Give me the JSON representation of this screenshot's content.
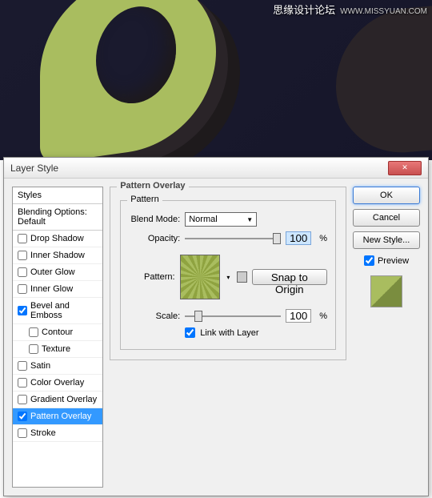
{
  "watermark": {
    "text": "思缘设计论坛",
    "url": "WWW.MISSYUAN.COM"
  },
  "dialog": {
    "title": "Layer Style",
    "close": "✕",
    "styles_header": "Styles",
    "blending_options": "Blending Options: Default",
    "items": [
      {
        "label": "Drop Shadow",
        "checked": false,
        "indent": false
      },
      {
        "label": "Inner Shadow",
        "checked": false,
        "indent": false
      },
      {
        "label": "Outer Glow",
        "checked": false,
        "indent": false
      },
      {
        "label": "Inner Glow",
        "checked": false,
        "indent": false
      },
      {
        "label": "Bevel and Emboss",
        "checked": true,
        "indent": false
      },
      {
        "label": "Contour",
        "checked": false,
        "indent": true
      },
      {
        "label": "Texture",
        "checked": false,
        "indent": true
      },
      {
        "label": "Satin",
        "checked": false,
        "indent": false
      },
      {
        "label": "Color Overlay",
        "checked": false,
        "indent": false
      },
      {
        "label": "Gradient Overlay",
        "checked": false,
        "indent": false
      },
      {
        "label": "Pattern Overlay",
        "checked": true,
        "indent": false,
        "selected": true
      },
      {
        "label": "Stroke",
        "checked": false,
        "indent": false
      }
    ],
    "panel": {
      "title": "Pattern Overlay",
      "subtitle": "Pattern",
      "blend_mode_label": "Blend Mode:",
      "blend_mode_value": "Normal",
      "opacity_label": "Opacity:",
      "opacity_value": "100",
      "opacity_unit": "%",
      "pattern_label": "Pattern:",
      "snap_label": "Snap to Origin",
      "scale_label": "Scale:",
      "scale_value": "100",
      "scale_unit": "%",
      "link_label": "Link with Layer",
      "link_checked": true
    },
    "buttons": {
      "ok": "OK",
      "cancel": "Cancel",
      "new_style": "New Style...",
      "preview": "Preview",
      "preview_checked": true
    }
  }
}
